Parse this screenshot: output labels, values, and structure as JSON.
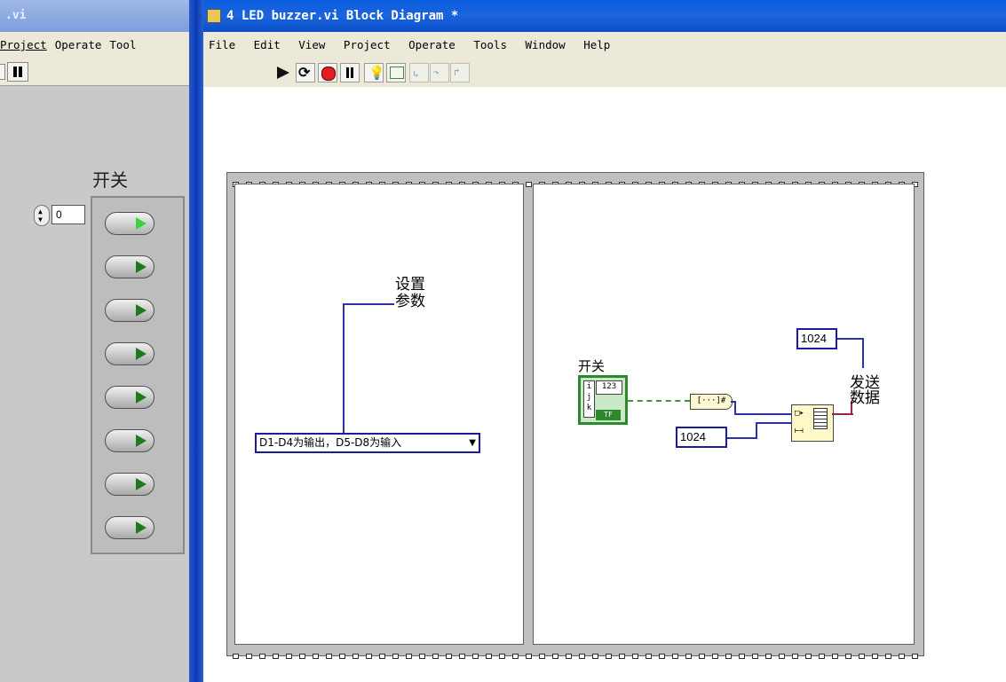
{
  "left_window": {
    "title": ".vi",
    "menu": [
      "Project",
      "Operate",
      "Tool"
    ],
    "panel": {
      "switch_label": "开关",
      "index_value": "0",
      "leds": [
        {
          "state": "on"
        },
        {
          "state": "off"
        },
        {
          "state": "off"
        },
        {
          "state": "off"
        },
        {
          "state": "off"
        },
        {
          "state": "off"
        },
        {
          "state": "off"
        },
        {
          "state": "off"
        }
      ]
    }
  },
  "right_window": {
    "title": "4 LED buzzer.vi Block Diagram *",
    "menu": [
      "File",
      "Edit",
      "View",
      "Project",
      "Operate",
      "Tools",
      "Window",
      "Help"
    ],
    "toolbar_icons": [
      "run-continuous-icon",
      "run-icon",
      "abort-icon",
      "pause-icon",
      "highlight-execution-icon",
      "retain-wire-values-icon",
      "step-into-icon",
      "step-over-icon",
      "step-out-icon"
    ]
  },
  "diagram": {
    "frame1": {
      "comment": "设置\n参数",
      "dropdown_value": "D1-D4为输出，D5-D8为输入"
    },
    "frame2": {
      "switch_label": "开关",
      "terminal_top": "123",
      "terminal_rows": [
        "i",
        "j",
        "k"
      ],
      "terminal_bottom": "TF",
      "converter_text": "[···]#",
      "const_top": "1024",
      "const_bottom": "1024",
      "comment": "发送\n数据"
    }
  },
  "colors": {
    "title_active": "#0a4ec8",
    "wire_blue": "#2f2fa8",
    "wire_green": "#3a9a3a",
    "led_on": "#39d439",
    "led_off": "#1f7a1f"
  }
}
